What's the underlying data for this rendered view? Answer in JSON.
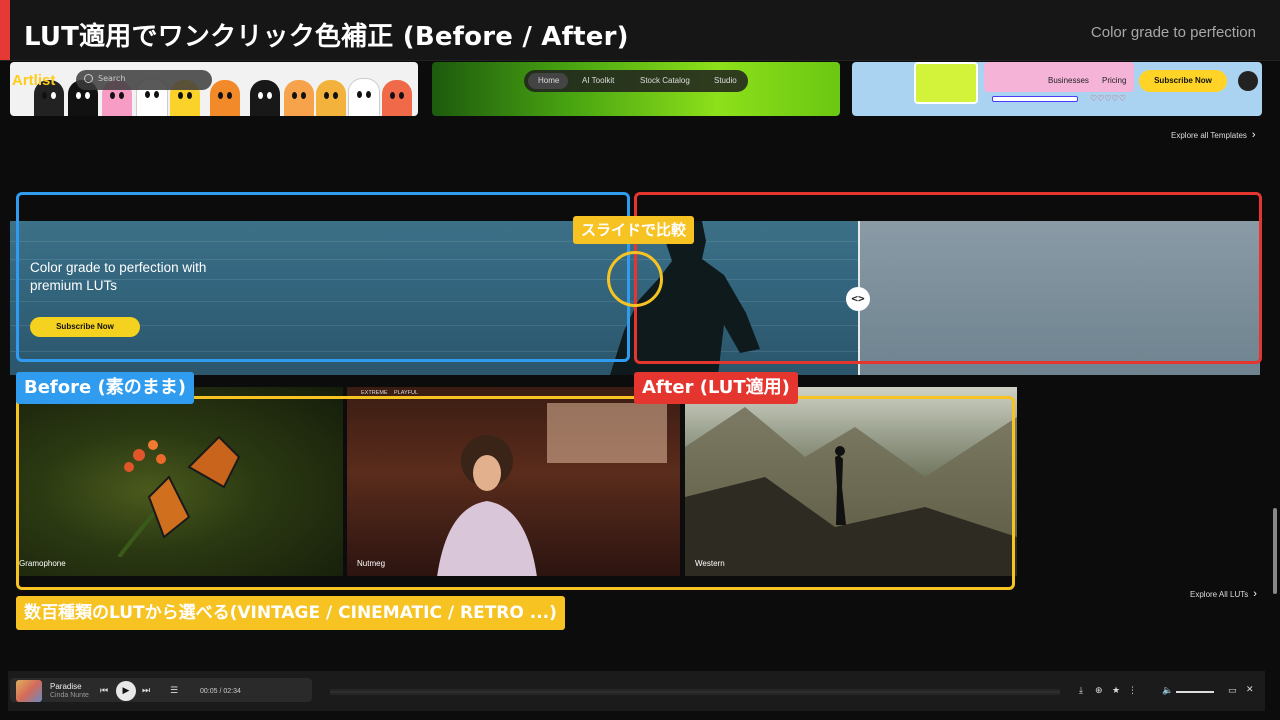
{
  "header": {
    "title": "LUT適用でワンクリック色補正 (Before / After)",
    "subtitle": "Color grade to perfection"
  },
  "templates": {
    "logo": "Artlist",
    "search_placeholder": "Search",
    "nav": [
      "Home",
      "AI Toolkit",
      "Stock Catalog",
      "Studio"
    ],
    "links": [
      "Businesses",
      "Pricing"
    ],
    "subscribe_label": "Subscribe Now",
    "explore_label": "Explore all Templates"
  },
  "banner": {
    "heading": "Color grade to perfection with premium LUTs",
    "subscribe_label": "Subscribe Now",
    "handle_glyph": "<>"
  },
  "annotations": {
    "slide_label": "スライドで比較",
    "before_label": "Before (素のまま)",
    "after_label": "After (LUT適用)",
    "luts_label": "数百種類のLUTから選べる(VINTAGE / CINEMATIC / RETRO ...)",
    "colors": {
      "before": "#2f9cf0",
      "after": "#e5352f",
      "highlight": "#f7c322"
    }
  },
  "luts": {
    "items": [
      {
        "name": "Gramophone",
        "tags": []
      },
      {
        "name": "Nutmeg",
        "tags": [
          "EXTREME",
          "PLAYFUL"
        ]
      },
      {
        "name": "Western",
        "tags": []
      }
    ],
    "explore_label": "Explore All LUTs"
  },
  "player": {
    "track_title": "Paradise",
    "track_artist": "Cinda Nunte",
    "time": "00:05 / 02:34",
    "icons": [
      "prev-icon",
      "play-icon",
      "next-icon",
      "queue-icon",
      "download-icon",
      "add-icon",
      "favorite-icon",
      "more-icon",
      "volume-icon",
      "pip-icon",
      "close-icon"
    ]
  }
}
